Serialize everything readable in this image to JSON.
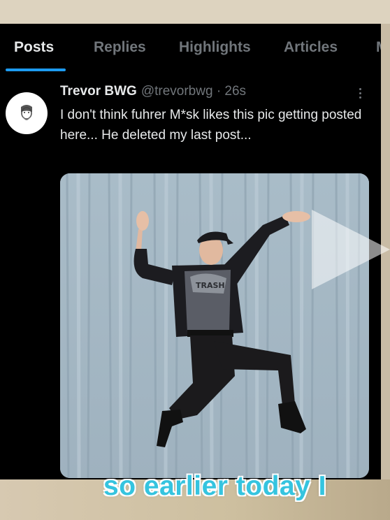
{
  "tabs": [
    {
      "label": "Posts",
      "active": true
    },
    {
      "label": "Replies",
      "active": false
    },
    {
      "label": "Highlights",
      "active": false
    },
    {
      "label": "Articles",
      "active": false
    },
    {
      "label": "M",
      "active": false
    }
  ],
  "post": {
    "author_name": "Trevor BWG",
    "handle": "@trevorbwg",
    "separator": "·",
    "time": "26s",
    "text": "I don't think fuhrer M*sk likes this pic getting posted here... He deleted my last post...",
    "media_icon": "video-play-icon"
  },
  "shirt_text": "TRASH",
  "caption": "so earlier today I",
  "colors": {
    "accent": "#1d9bf0",
    "screen_bg": "#000000",
    "caption": "#35c4df"
  }
}
